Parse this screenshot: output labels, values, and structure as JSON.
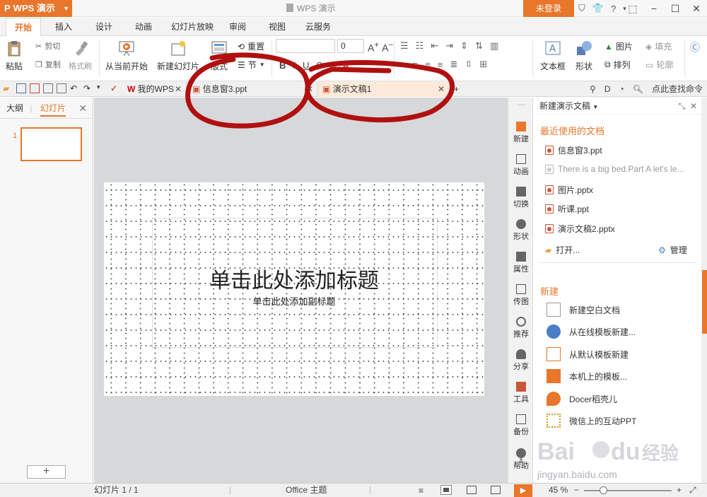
{
  "titlebar": {
    "app_menu": "WPS 演示",
    "window_title": "WPS 演示",
    "login": "未登录",
    "help": "?"
  },
  "ribbon_tabs": [
    "开始",
    "插入",
    "设计",
    "动画",
    "幻灯片放映",
    "审阅",
    "视图",
    "云服务"
  ],
  "ribbon": {
    "paste": "粘贴",
    "cut": "剪切",
    "copy": "复制",
    "format_painter": "格式刷",
    "from_current": "从当前开始",
    "new_slide": "新建幻灯片",
    "layout": "版式",
    "reset": "重置",
    "section": "节",
    "font_size": "0",
    "textbox": "文本框",
    "shape": "形状",
    "picture": "图片",
    "fill": "填充",
    "arrange": "排列",
    "outline": "轮廓"
  },
  "doc_tabs": {
    "tabs": [
      {
        "label": "我的WPS"
      },
      {
        "label": "信息窗3.ppt"
      },
      {
        "label": "演示文稿1"
      }
    ],
    "find": "点此查找命令"
  },
  "left_panel": {
    "outline_tab": "大纲",
    "slides_tab": "幻灯片",
    "slide_number": "1",
    "add": "+"
  },
  "slide": {
    "title_placeholder": "单击此处添加标题",
    "subtitle_placeholder": "单击此处添加副标题"
  },
  "side_toolbar": [
    "新建",
    "动画",
    "切换",
    "形状",
    "属性",
    "传图",
    "推荐",
    "分享",
    "工具",
    "备份",
    "帮助"
  ],
  "task_pane": {
    "header": "新建演示文稿",
    "recent_title": "最近使用的文档",
    "recent": [
      {
        "name": "信息窗3.ppt"
      },
      {
        "name": "There is a big bed.Part A let's le..."
      },
      {
        "name": "图片.pptx"
      },
      {
        "name": "听课.ppt"
      },
      {
        "name": "演示文稿2.pptx"
      }
    ],
    "open": "打开...",
    "manage": "管理",
    "new_title": "新建",
    "new_items": [
      {
        "label": "新建空白文档"
      },
      {
        "label": "从在线模板新建..."
      },
      {
        "label": "从默认模板新建"
      },
      {
        "label": "本机上的模板..."
      },
      {
        "label": "Docer稻壳儿"
      },
      {
        "label": "微信上的互动PPT"
      }
    ]
  },
  "status": {
    "slide_info": "幻灯片 1 / 1",
    "theme": "Office 主题",
    "zoom": "45 %"
  },
  "watermark": {
    "brand": "Baidu 经验",
    "url": "jingyan.baidu.com"
  },
  "colors": {
    "accent": "#e8762b",
    "annotation": "#b01010"
  }
}
